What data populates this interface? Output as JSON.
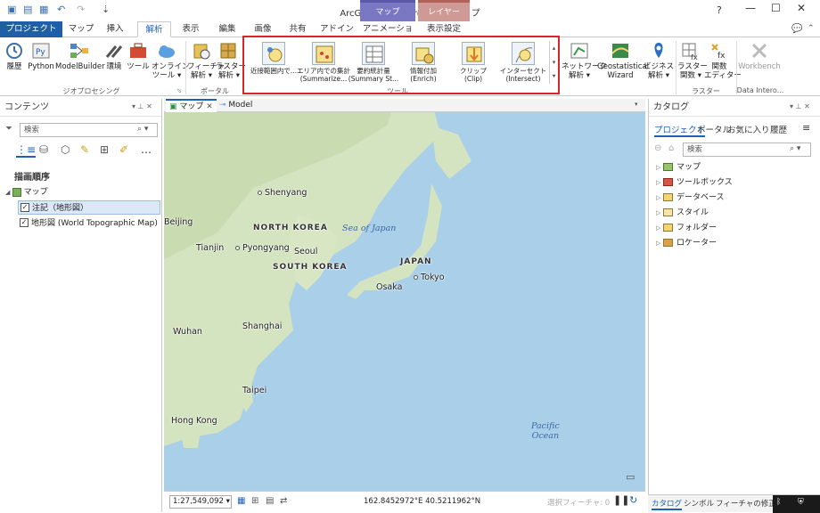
{
  "window": {
    "title": "ArcGIS Pro - MyProject7 - マップ",
    "help": "?",
    "minimize": "—",
    "maximize": "☐",
    "close": "✕"
  },
  "context_groups": [
    {
      "label": "マップ",
      "color": "#7a78c2"
    },
    {
      "label": "レイヤー",
      "color": "#c88f8a"
    }
  ],
  "tabs": [
    {
      "label": "プロジェクト"
    },
    {
      "label": "マップ"
    },
    {
      "label": "挿入"
    },
    {
      "label": "解析"
    },
    {
      "label": "表示"
    },
    {
      "label": "編集"
    },
    {
      "label": "画像"
    },
    {
      "label": "共有"
    },
    {
      "label": "アドイン"
    },
    {
      "label": "アニメーション"
    },
    {
      "label": "表示設定"
    }
  ],
  "ribbon": {
    "geoprocessing": {
      "label": "ジオプロセシング",
      "buttons": [
        "履歴",
        "Python",
        "ModelBuilder",
        "環境",
        "ツール",
        "オンライン\nツール ▾"
      ]
    },
    "portal": {
      "label": "ポータル",
      "buttons": [
        "フィーチャ\n解析 ▾",
        "ラスター\n解析 ▾"
      ]
    },
    "tools": {
      "label": "ツール",
      "items": [
        "近接範囲内で...",
        "エリア内での集計\n(Summarize...",
        "要約統計量\n(Summary St...",
        "情報付加\n(Enrich)",
        "クリップ\n(Clip)",
        "インターセクト\n(Intersect)"
      ]
    },
    "other": {
      "buttons": [
        "ネットワーク\n解析 ▾",
        "Geostatistical\nWizard",
        "ビジネス\n解析 ▾",
        "ラスター\n関数 ▾",
        "関数\nエディター",
        "Workbench"
      ]
    },
    "raster_label": "ラスター",
    "interop_label": "Data Intero..."
  },
  "contents": {
    "title": "コンテンツ",
    "search_placeholder": "検索",
    "draw_order": "描画順序",
    "map": "マップ",
    "layers": [
      "注記（地形図）",
      "地形図 (World Topographic Map)"
    ]
  },
  "map_tabs": {
    "map": "マップ",
    "model": "Model"
  },
  "map_labels": {
    "cities": [
      "Shenyang",
      "Beijing",
      "Tianjin",
      "Pyongyang",
      "Seoul",
      "Osaka",
      "Tokyo",
      "Shanghai",
      "Wuhan",
      "Taipei",
      "Hong Kong"
    ],
    "countries": [
      "NORTH KOREA",
      "SOUTH KOREA",
      "JAPAN"
    ],
    "seas": [
      "Sea of Japan",
      "Pacific\nOcean"
    ]
  },
  "statusbar": {
    "scale": "1:27,549,092",
    "coords": "162.8452972°E 40.5211962°N",
    "selected": "選択フィーチャ: 0"
  },
  "catalog": {
    "title": "カタログ",
    "tabs": [
      "プロジェクト",
      "ポータル",
      "お気に入り",
      "履歴"
    ],
    "search_placeholder": "検索",
    "items": [
      "マップ",
      "ツールボックス",
      "データベース",
      "スタイル",
      "フォルダー",
      "ロケーター"
    ],
    "bottom_tabs": [
      "カタログ",
      "シンボル",
      "フィーチャの修正"
    ]
  }
}
